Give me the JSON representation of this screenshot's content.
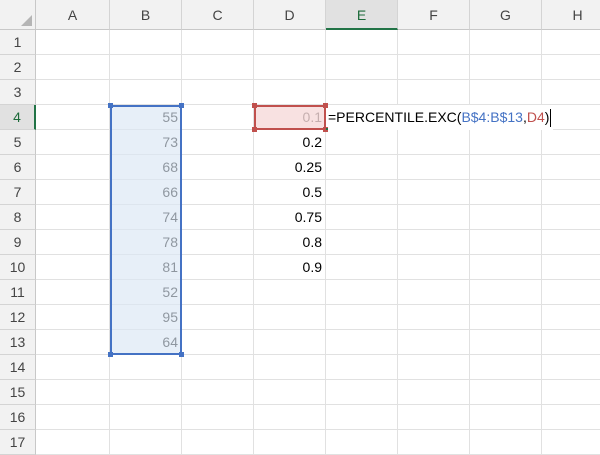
{
  "columns": [
    "A",
    "B",
    "C",
    "D",
    "E",
    "F",
    "G",
    "H"
  ],
  "rows": [
    "1",
    "2",
    "3",
    "4",
    "5",
    "6",
    "7",
    "8",
    "9",
    "10",
    "11",
    "12",
    "13",
    "14",
    "15",
    "16",
    "17"
  ],
  "active_column": "E",
  "active_row": "4",
  "column_b_values": [
    "55",
    "73",
    "68",
    "66",
    "74",
    "78",
    "81",
    "52",
    "95",
    "64"
  ],
  "column_d_values": [
    "0.1",
    "0.2",
    "0.25",
    "0.5",
    "0.75",
    "0.8",
    "0.9"
  ],
  "formula": {
    "prefix": "=PERCENTILE.EXC(",
    "ref1": "B$4:B$13",
    "separator": ",",
    "ref2": "D4",
    "suffix": ")"
  },
  "colors": {
    "ref1": "#4472c4",
    "ref2": "#c0504d",
    "active": "#217346"
  }
}
